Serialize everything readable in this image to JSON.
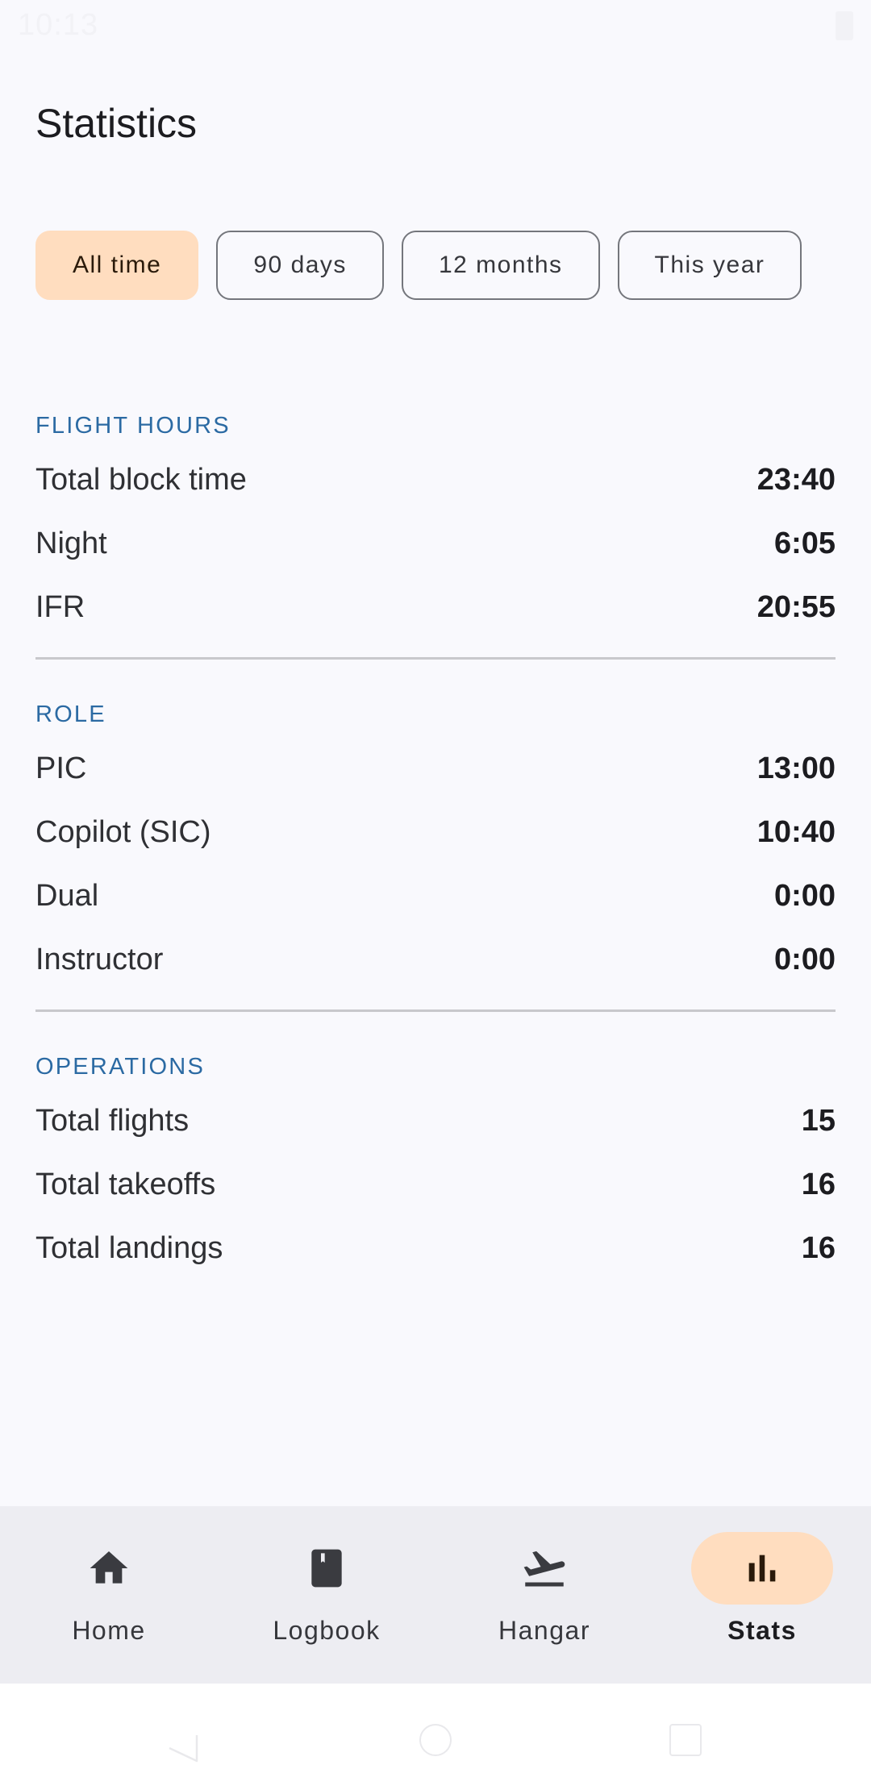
{
  "status_bar": {
    "time": "10:13"
  },
  "page": {
    "title": "Statistics"
  },
  "filters": {
    "chips": [
      {
        "label": "All time",
        "selected": true
      },
      {
        "label": "90 days",
        "selected": false
      },
      {
        "label": "12 months",
        "selected": false
      },
      {
        "label": "This year",
        "selected": false
      }
    ]
  },
  "sections": {
    "flight_hours": {
      "header": "FLIGHT HOURS",
      "rows": [
        {
          "label": "Total block time",
          "value": "23:40"
        },
        {
          "label": "Night",
          "value": "6:05"
        },
        {
          "label": "IFR",
          "value": "20:55"
        }
      ]
    },
    "role": {
      "header": "ROLE",
      "rows": [
        {
          "label": "PIC",
          "value": "13:00"
        },
        {
          "label": "Copilot (SIC)",
          "value": "10:40"
        },
        {
          "label": "Dual",
          "value": "0:00"
        },
        {
          "label": "Instructor",
          "value": "0:00"
        }
      ]
    },
    "operations": {
      "header": "OPERATIONS",
      "rows": [
        {
          "label": "Total flights",
          "value": "15"
        },
        {
          "label": "Total takeoffs",
          "value": "16"
        },
        {
          "label": "Total landings",
          "value": "16"
        }
      ]
    }
  },
  "bottom_nav": {
    "items": [
      {
        "label": "Home",
        "icon": "home-icon",
        "active": false
      },
      {
        "label": "Logbook",
        "icon": "book-icon",
        "active": false
      },
      {
        "label": "Hangar",
        "icon": "flight-takeoff-icon",
        "active": false
      },
      {
        "label": "Stats",
        "icon": "bar-chart-icon",
        "active": true
      }
    ]
  },
  "colors": {
    "background": "#f9f9fd",
    "accent_container": "#ffddbf",
    "section_header": "#2b6aa3",
    "nav_background": "#ededf2"
  }
}
